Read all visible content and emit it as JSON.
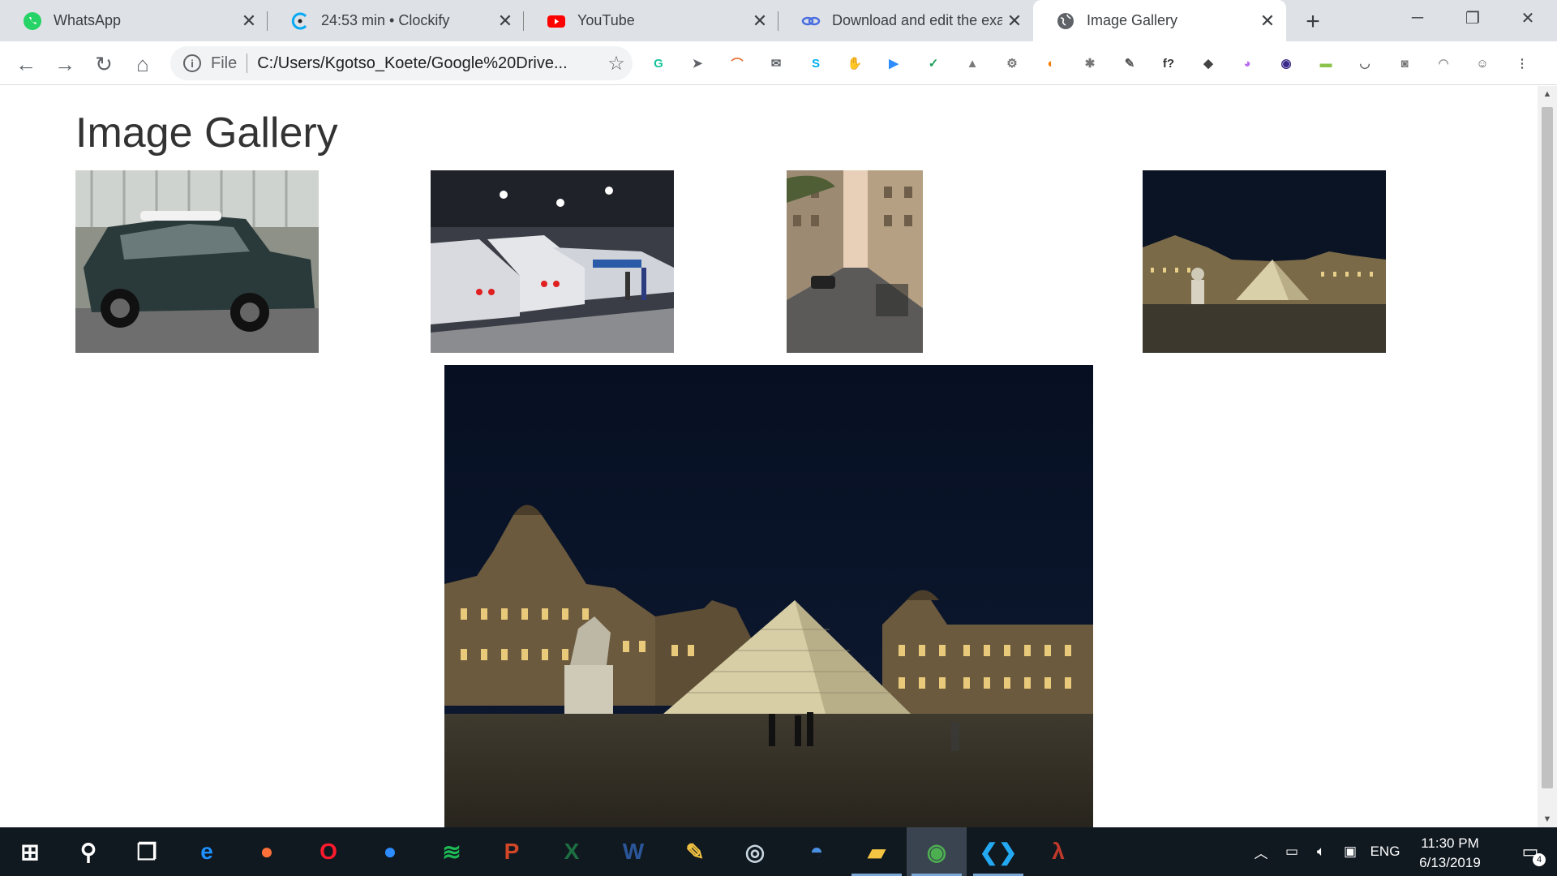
{
  "browser": {
    "tabs": [
      {
        "title": "WhatsApp",
        "icon": "whatsapp-icon",
        "color": "#25d366"
      },
      {
        "title": "24:53 min • Clockify",
        "icon": "clockify-icon",
        "color": "#03a9f4"
      },
      {
        "title": "YouTube",
        "icon": "youtube-icon",
        "color": "#ff0000"
      },
      {
        "title": "Download and edit the exa",
        "icon": "link-icon",
        "color": "#4a6ee0"
      },
      {
        "title": "Image Gallery",
        "icon": "globe-icon",
        "color": "#5f6368",
        "active": true
      }
    ],
    "address": {
      "scheme": "File",
      "url": "C:/Users/Kgotso_Koete/Google%20Drive..."
    },
    "extensions": [
      {
        "name": "grammarly-icon",
        "glyph": "G",
        "color": "#15c39a"
      },
      {
        "name": "bird-icon",
        "glyph": "➤",
        "color": "#5f6368"
      },
      {
        "name": "arc-icon",
        "glyph": "⌒",
        "color": "#e56b2e"
      },
      {
        "name": "mail-icon",
        "glyph": "✉",
        "color": "#5f6368"
      },
      {
        "name": "skype-icon",
        "glyph": "S",
        "color": "#00aff0"
      },
      {
        "name": "adblock-icon",
        "glyph": "✋",
        "color": "#e00000"
      },
      {
        "name": "zoom-icon",
        "glyph": "▶",
        "color": "#2d8cff"
      },
      {
        "name": "shield-icon",
        "glyph": "✓",
        "color": "#1e9e5a"
      },
      {
        "name": "drive-icon",
        "glyph": "▲",
        "color": "#7a7a7a"
      },
      {
        "name": "gear-icon",
        "glyph": "⚙",
        "color": "#777"
      },
      {
        "name": "swirl-icon",
        "glyph": "◐",
        "color": "#f57c00"
      },
      {
        "name": "bug-icon",
        "glyph": "✱",
        "color": "#777"
      },
      {
        "name": "eyedropper-icon",
        "glyph": "✎",
        "color": "#555"
      },
      {
        "name": "function-icon",
        "glyph": "f?",
        "color": "#333"
      },
      {
        "name": "layers-icon",
        "glyph": "◆",
        "color": "#444"
      },
      {
        "name": "gradient-icon",
        "glyph": "◕",
        "color": "#b86cf0"
      },
      {
        "name": "colorwheel-icon",
        "glyph": "◉",
        "color": "#3b2a8a"
      },
      {
        "name": "folder-green-icon",
        "glyph": "▬",
        "color": "#8bc34a"
      },
      {
        "name": "pocket-icon",
        "glyph": "◡",
        "color": "#666"
      },
      {
        "name": "camera-icon",
        "glyph": "◙",
        "color": "#777"
      },
      {
        "name": "rainbow-icon",
        "glyph": "◠",
        "color": "#999"
      },
      {
        "name": "profile-icon",
        "glyph": "☺",
        "color": "#555"
      },
      {
        "name": "menu-dots-icon",
        "glyph": "⋮",
        "color": "#5f6368"
      }
    ]
  },
  "page": {
    "title": "Image Gallery",
    "thumbnails": [
      {
        "name": "thumbnail-mini-car",
        "subject": "mini-car"
      },
      {
        "name": "thumbnail-trains",
        "subject": "trains"
      },
      {
        "name": "thumbnail-street",
        "subject": "street"
      },
      {
        "name": "thumbnail-louvre",
        "subject": "louvre"
      }
    ],
    "featured": {
      "subject": "louvre"
    }
  },
  "taskbar": {
    "apps": [
      {
        "name": "start-button",
        "glyph": "⊞",
        "color": "#ffffff"
      },
      {
        "name": "search-icon",
        "glyph": "⚲",
        "color": "#ffffff"
      },
      {
        "name": "task-view-icon",
        "glyph": "❐",
        "color": "#ffffff"
      },
      {
        "name": "edge-icon",
        "glyph": "e",
        "color": "#1e90ff"
      },
      {
        "name": "firefox-icon",
        "glyph": "●",
        "color": "#ff7139"
      },
      {
        "name": "opera-icon",
        "glyph": "O",
        "color": "#ff1b2d"
      },
      {
        "name": "zoom-app-icon",
        "glyph": "●",
        "color": "#2d8cff"
      },
      {
        "name": "spotify-icon",
        "glyph": "≋",
        "color": "#1db954"
      },
      {
        "name": "powerpoint-icon",
        "glyph": "P",
        "color": "#d24726"
      },
      {
        "name": "excel-icon",
        "glyph": "X",
        "color": "#1d6f42"
      },
      {
        "name": "word-icon",
        "glyph": "W",
        "color": "#2b579a"
      },
      {
        "name": "paint-icon",
        "glyph": "✎",
        "color": "#f0c040"
      },
      {
        "name": "steam-icon",
        "glyph": "◎",
        "color": "#c7d5e0"
      },
      {
        "name": "vpn-icon",
        "glyph": "◓",
        "color": "#4a90e2"
      },
      {
        "name": "file-explorer-icon",
        "glyph": "▰",
        "color": "#f4c542"
      },
      {
        "name": "chrome-icon",
        "glyph": "◉",
        "color": "#4caf50"
      },
      {
        "name": "vscode-icon",
        "glyph": "❮❯",
        "color": "#23a9f2"
      },
      {
        "name": "racket-icon",
        "glyph": "λ",
        "color": "#c0392b"
      }
    ],
    "tray": {
      "language": "ENG",
      "time": "11:30 PM",
      "date": "6/13/2019",
      "notifications": "4"
    }
  }
}
